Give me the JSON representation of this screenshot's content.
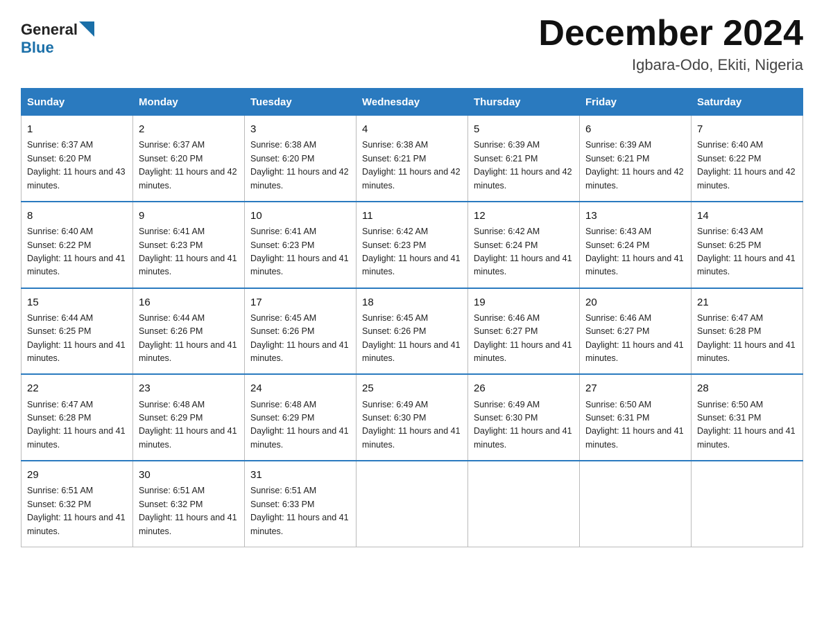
{
  "header": {
    "logo_general": "General",
    "logo_blue": "Blue",
    "month_title": "December 2024",
    "subtitle": "Igbara-Odo, Ekiti, Nigeria"
  },
  "calendar": {
    "days_of_week": [
      "Sunday",
      "Monday",
      "Tuesday",
      "Wednesday",
      "Thursday",
      "Friday",
      "Saturday"
    ],
    "weeks": [
      [
        {
          "day": "1",
          "sunrise": "Sunrise: 6:37 AM",
          "sunset": "Sunset: 6:20 PM",
          "daylight": "Daylight: 11 hours and 43 minutes."
        },
        {
          "day": "2",
          "sunrise": "Sunrise: 6:37 AM",
          "sunset": "Sunset: 6:20 PM",
          "daylight": "Daylight: 11 hours and 42 minutes."
        },
        {
          "day": "3",
          "sunrise": "Sunrise: 6:38 AM",
          "sunset": "Sunset: 6:20 PM",
          "daylight": "Daylight: 11 hours and 42 minutes."
        },
        {
          "day": "4",
          "sunrise": "Sunrise: 6:38 AM",
          "sunset": "Sunset: 6:21 PM",
          "daylight": "Daylight: 11 hours and 42 minutes."
        },
        {
          "day": "5",
          "sunrise": "Sunrise: 6:39 AM",
          "sunset": "Sunset: 6:21 PM",
          "daylight": "Daylight: 11 hours and 42 minutes."
        },
        {
          "day": "6",
          "sunrise": "Sunrise: 6:39 AM",
          "sunset": "Sunset: 6:21 PM",
          "daylight": "Daylight: 11 hours and 42 minutes."
        },
        {
          "day": "7",
          "sunrise": "Sunrise: 6:40 AM",
          "sunset": "Sunset: 6:22 PM",
          "daylight": "Daylight: 11 hours and 42 minutes."
        }
      ],
      [
        {
          "day": "8",
          "sunrise": "Sunrise: 6:40 AM",
          "sunset": "Sunset: 6:22 PM",
          "daylight": "Daylight: 11 hours and 41 minutes."
        },
        {
          "day": "9",
          "sunrise": "Sunrise: 6:41 AM",
          "sunset": "Sunset: 6:23 PM",
          "daylight": "Daylight: 11 hours and 41 minutes."
        },
        {
          "day": "10",
          "sunrise": "Sunrise: 6:41 AM",
          "sunset": "Sunset: 6:23 PM",
          "daylight": "Daylight: 11 hours and 41 minutes."
        },
        {
          "day": "11",
          "sunrise": "Sunrise: 6:42 AM",
          "sunset": "Sunset: 6:23 PM",
          "daylight": "Daylight: 11 hours and 41 minutes."
        },
        {
          "day": "12",
          "sunrise": "Sunrise: 6:42 AM",
          "sunset": "Sunset: 6:24 PM",
          "daylight": "Daylight: 11 hours and 41 minutes."
        },
        {
          "day": "13",
          "sunrise": "Sunrise: 6:43 AM",
          "sunset": "Sunset: 6:24 PM",
          "daylight": "Daylight: 11 hours and 41 minutes."
        },
        {
          "day": "14",
          "sunrise": "Sunrise: 6:43 AM",
          "sunset": "Sunset: 6:25 PM",
          "daylight": "Daylight: 11 hours and 41 minutes."
        }
      ],
      [
        {
          "day": "15",
          "sunrise": "Sunrise: 6:44 AM",
          "sunset": "Sunset: 6:25 PM",
          "daylight": "Daylight: 11 hours and 41 minutes."
        },
        {
          "day": "16",
          "sunrise": "Sunrise: 6:44 AM",
          "sunset": "Sunset: 6:26 PM",
          "daylight": "Daylight: 11 hours and 41 minutes."
        },
        {
          "day": "17",
          "sunrise": "Sunrise: 6:45 AM",
          "sunset": "Sunset: 6:26 PM",
          "daylight": "Daylight: 11 hours and 41 minutes."
        },
        {
          "day": "18",
          "sunrise": "Sunrise: 6:45 AM",
          "sunset": "Sunset: 6:26 PM",
          "daylight": "Daylight: 11 hours and 41 minutes."
        },
        {
          "day": "19",
          "sunrise": "Sunrise: 6:46 AM",
          "sunset": "Sunset: 6:27 PM",
          "daylight": "Daylight: 11 hours and 41 minutes."
        },
        {
          "day": "20",
          "sunrise": "Sunrise: 6:46 AM",
          "sunset": "Sunset: 6:27 PM",
          "daylight": "Daylight: 11 hours and 41 minutes."
        },
        {
          "day": "21",
          "sunrise": "Sunrise: 6:47 AM",
          "sunset": "Sunset: 6:28 PM",
          "daylight": "Daylight: 11 hours and 41 minutes."
        }
      ],
      [
        {
          "day": "22",
          "sunrise": "Sunrise: 6:47 AM",
          "sunset": "Sunset: 6:28 PM",
          "daylight": "Daylight: 11 hours and 41 minutes."
        },
        {
          "day": "23",
          "sunrise": "Sunrise: 6:48 AM",
          "sunset": "Sunset: 6:29 PM",
          "daylight": "Daylight: 11 hours and 41 minutes."
        },
        {
          "day": "24",
          "sunrise": "Sunrise: 6:48 AM",
          "sunset": "Sunset: 6:29 PM",
          "daylight": "Daylight: 11 hours and 41 minutes."
        },
        {
          "day": "25",
          "sunrise": "Sunrise: 6:49 AM",
          "sunset": "Sunset: 6:30 PM",
          "daylight": "Daylight: 11 hours and 41 minutes."
        },
        {
          "day": "26",
          "sunrise": "Sunrise: 6:49 AM",
          "sunset": "Sunset: 6:30 PM",
          "daylight": "Daylight: 11 hours and 41 minutes."
        },
        {
          "day": "27",
          "sunrise": "Sunrise: 6:50 AM",
          "sunset": "Sunset: 6:31 PM",
          "daylight": "Daylight: 11 hours and 41 minutes."
        },
        {
          "day": "28",
          "sunrise": "Sunrise: 6:50 AM",
          "sunset": "Sunset: 6:31 PM",
          "daylight": "Daylight: 11 hours and 41 minutes."
        }
      ],
      [
        {
          "day": "29",
          "sunrise": "Sunrise: 6:51 AM",
          "sunset": "Sunset: 6:32 PM",
          "daylight": "Daylight: 11 hours and 41 minutes."
        },
        {
          "day": "30",
          "sunrise": "Sunrise: 6:51 AM",
          "sunset": "Sunset: 6:32 PM",
          "daylight": "Daylight: 11 hours and 41 minutes."
        },
        {
          "day": "31",
          "sunrise": "Sunrise: 6:51 AM",
          "sunset": "Sunset: 6:33 PM",
          "daylight": "Daylight: 11 hours and 41 minutes."
        },
        null,
        null,
        null,
        null
      ]
    ]
  }
}
